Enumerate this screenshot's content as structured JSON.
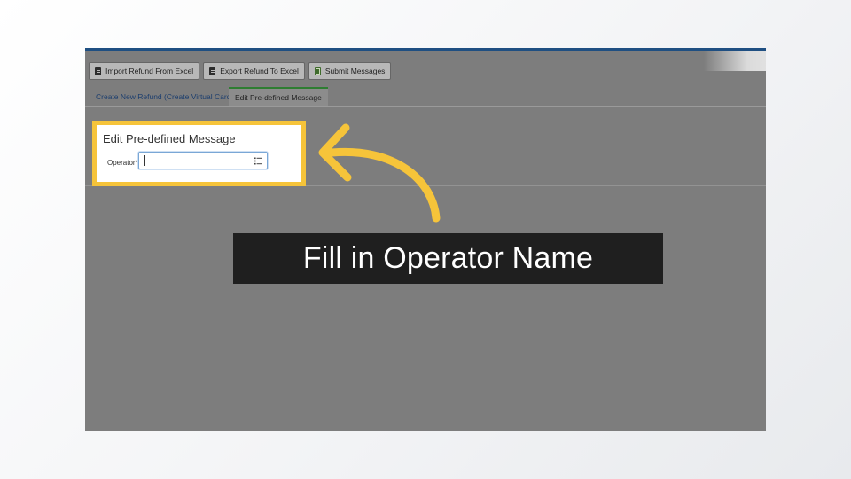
{
  "toolbar": {
    "import_label": "Import Refund From Excel",
    "export_label": "Export Refund To Excel",
    "submit_label": "Submit Messages"
  },
  "tabs": {
    "create_label": "Create New Refund (Create Virtual Card)",
    "edit_label": "Edit Pre-defined Message"
  },
  "panel": {
    "title": "Edit Pre-defined Message",
    "operator_label": "Operator*",
    "operator_value": ""
  },
  "callout": {
    "text": "Fill in Operator Name"
  },
  "colors": {
    "highlight": "#f6c43a",
    "callout_bg": "#1f1f1f",
    "top_bar": "#1f4f82",
    "overlay": "#7d7d7d"
  },
  "icons": {
    "import": "file-icon",
    "export": "file-icon",
    "submit": "spreadsheet-icon",
    "operator_picker": "list-icon",
    "pointer": "curved-arrow-icon"
  }
}
